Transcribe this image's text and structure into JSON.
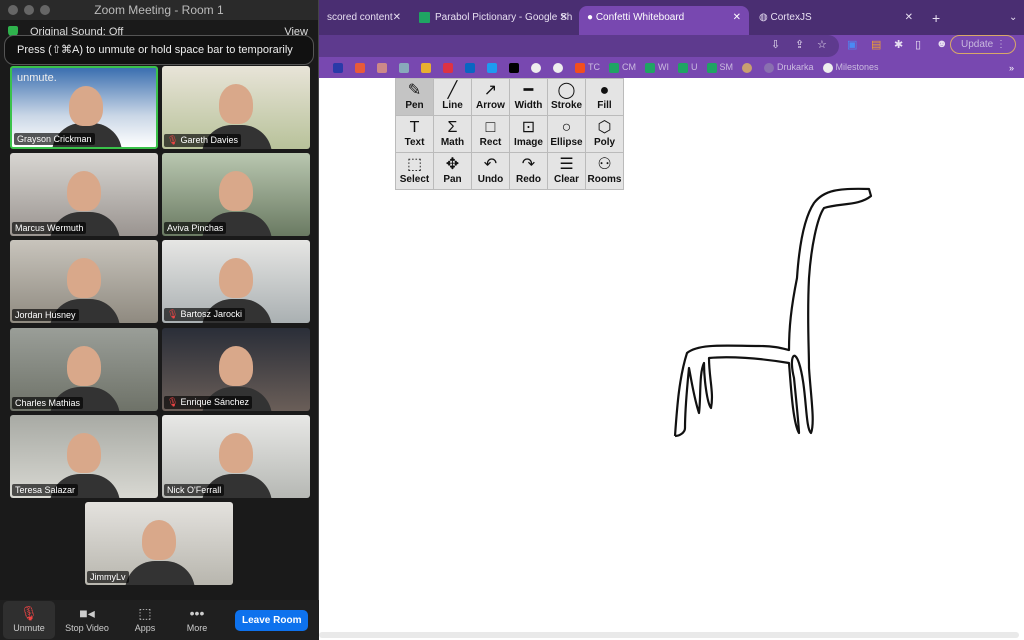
{
  "zoom": {
    "title": "Zoom Meeting - Room 1",
    "original_sound": "Original Sound: Off",
    "view_label": "View",
    "toast": "Press  (⇧⌘A) to unmute or hold space bar to temporarily unmute.",
    "participants": [
      {
        "name": "Grayson Crickman",
        "muted": false,
        "active": true
      },
      {
        "name": "Gareth Davies",
        "muted": true
      },
      {
        "name": "Marcus Wermuth",
        "muted": false
      },
      {
        "name": "Aviva Pinchas",
        "muted": false
      },
      {
        "name": "Jordan Husney",
        "muted": false
      },
      {
        "name": "Bartosz Jarocki",
        "muted": true
      },
      {
        "name": "Charles Mathias",
        "muted": false
      },
      {
        "name": "Enrique Sánchez",
        "muted": true
      },
      {
        "name": "Teresa Salazar",
        "muted": false
      },
      {
        "name": "Nick O'Ferrall",
        "muted": false
      },
      {
        "name": "JimmyLv",
        "muted": false
      }
    ],
    "controls": {
      "unmute": "Unmute",
      "stop_video": "Stop Video",
      "apps": "Apps",
      "more": "More",
      "leave": "Leave Room"
    }
  },
  "browser": {
    "tabs": [
      {
        "title": "scored content"
      },
      {
        "title": "Parabol Pictionary - Google Sh"
      },
      {
        "title": "Confetti Whiteboard",
        "active": true
      },
      {
        "title": "CortexJS"
      }
    ],
    "update_label": "Update",
    "bookmarks": [
      "TC",
      "CM",
      "WI",
      "U",
      "SM",
      "Drukarka",
      "Milestones"
    ]
  },
  "whiteboard": {
    "tools": [
      "Pen",
      "Line",
      "Arrow",
      "Width",
      "Stroke",
      "Fill",
      "Text",
      "Math",
      "Rect",
      "Image",
      "Ellipse",
      "Poly",
      "Select",
      "Pan",
      "Undo",
      "Redo",
      "Clear",
      "Rooms"
    ],
    "selected_tool": "Pen"
  }
}
